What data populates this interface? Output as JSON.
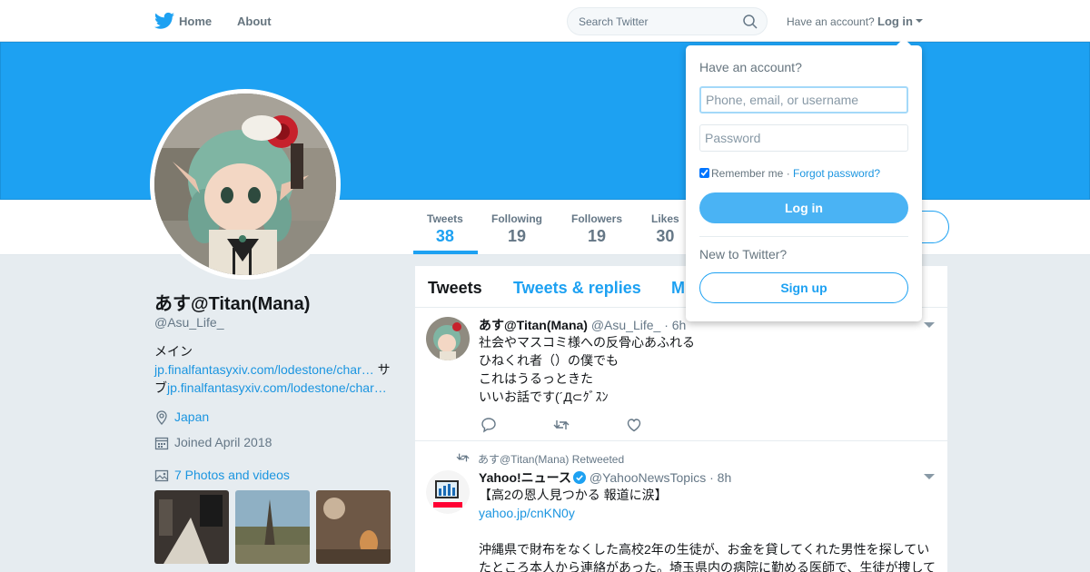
{
  "nav": {
    "home_label": "Home",
    "about_label": "About",
    "search_placeholder": "Search Twitter",
    "have_account_label": "Have an account?",
    "login_label": "Log in"
  },
  "profile": {
    "name": "あす@Titan(Mana)",
    "handle": "@Asu_Life_",
    "bio_prefix": "メイン",
    "bio_link1": "jp.finalfantasyxiv.com/lodestone/char…",
    "bio_mid": " サブ",
    "bio_link2": "jp.finalfantasyxiv.com/lodestone/char…",
    "location": "Japan",
    "joined": "Joined April 2018",
    "photos_label": "7 Photos and videos"
  },
  "stats": [
    {
      "label": "Tweets",
      "value": "38"
    },
    {
      "label": "Following",
      "value": "19"
    },
    {
      "label": "Followers",
      "value": "19"
    },
    {
      "label": "Likes",
      "value": "30"
    }
  ],
  "timeline_tabs": [
    "Tweets",
    "Tweets & replies",
    "M"
  ],
  "tweets": [
    {
      "name": "あす@Titan(Mana)",
      "handle": "@Asu_Life_",
      "time": "· 6h",
      "lines": [
        "社会やマスコミ様への反骨心あふれる",
        "ひねくれ者（）の僕でも",
        "これはうるっときた",
        "いいお話です(´Д⊂ｸﾞｽﾝ"
      ]
    },
    {
      "retweet_context": "あす@Titan(Mana) Retweeted",
      "name": "Yahoo!ニュース",
      "handle": "@YahooNewsTopics",
      "time": "· 8h",
      "line1": "【高2の恩人見つかる 報道に涙】",
      "link": "yahoo.jp/cnKN0y",
      "line2": "沖縄県で財布をなくした高校2年の生徒が、お金を貸してくれた男性を探してい",
      "line3": "たところ本人から連絡があった。埼玉県内の病院に勤める医師で、生徒が捜して"
    }
  ],
  "login_dropdown": {
    "title": "Have an account?",
    "username_placeholder": "Phone, email, or username",
    "password_placeholder": "Password",
    "remember_label": "Remember me",
    "separator": " · ",
    "forgot_label": "Forgot password?",
    "login_button": "Log in",
    "new_label": "New to Twitter?",
    "signup_button": "Sign up"
  },
  "colors": {
    "accent": "#1da1f2",
    "link": "#1b95e0",
    "banner": "#1da1f2",
    "login_button": "#4ab3f4"
  }
}
